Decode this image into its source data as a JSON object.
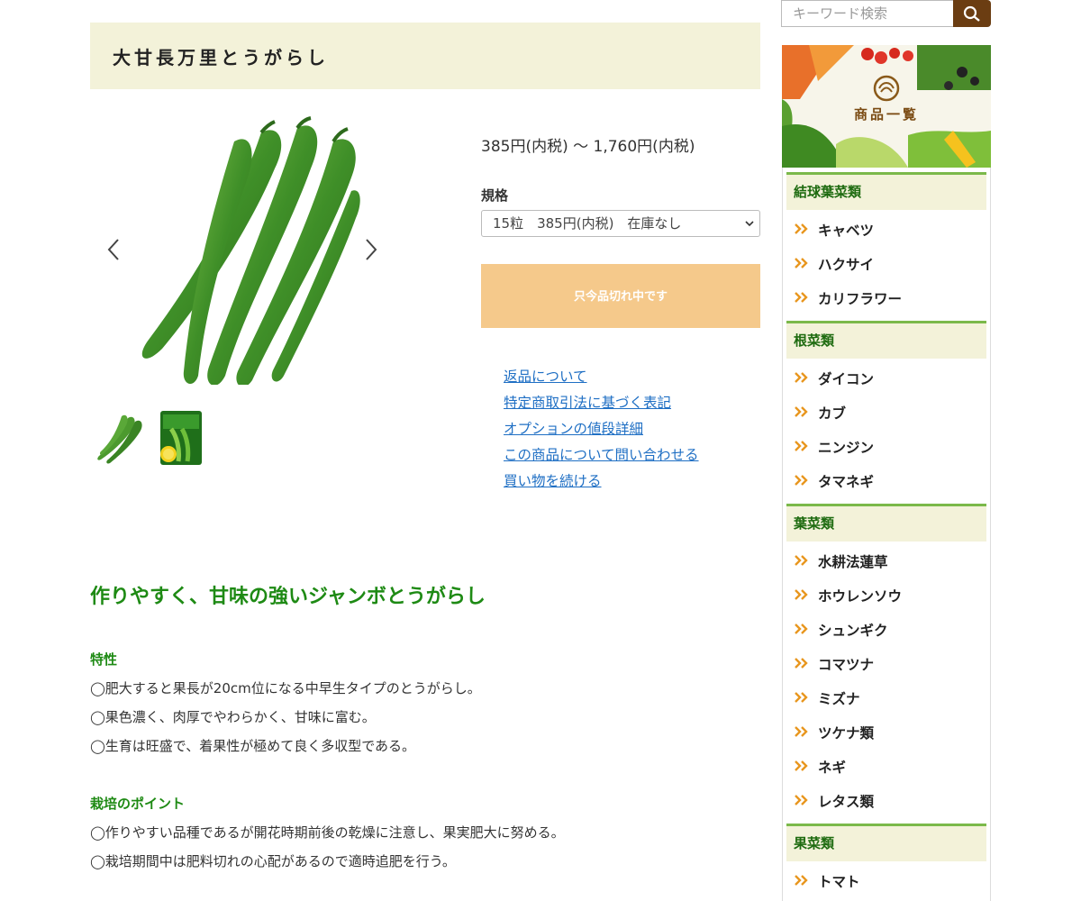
{
  "product": {
    "title": "大甘長万里とうがらし",
    "price": "385円(内税) 〜 1,760円(内税)",
    "spec_label": "規格",
    "spec_selected": "15粒　385円(内税)　在庫なし",
    "soldout_label": "只今品切れ中です",
    "links": [
      "返品について",
      "特定商取引法に基づく表記",
      "オプションの値段詳細",
      "この商品について問い合わせる",
      "買い物を続ける"
    ]
  },
  "description": {
    "catch": "作りやすく、甘味の強いジャンボとうがらし",
    "section1_title": "特性",
    "section1_lines": [
      "◯肥大すると果長が20cm位になる中早生タイプのとうがらし。",
      "◯果色濃く、肉厚でやわらかく、甘味に富む。",
      "◯生育は旺盛で、着果性が極めて良く多収型である。"
    ],
    "section2_title": "栽培のポイント",
    "section2_lines": [
      "◯作りやすい品種であるが開花時期前後の乾燥に注意し、果実肥大に努める。",
      "◯栽培期間中は肥料切れの心配があるので適時追肥を行う。"
    ]
  },
  "sidebar": {
    "search_placeholder": "キーワード検索",
    "banner_text": "商品一覧",
    "categories": [
      {
        "title": "結球葉菜類",
        "items": [
          "キャベツ",
          "ハクサイ",
          "カリフラワー"
        ]
      },
      {
        "title": "根菜類",
        "items": [
          "ダイコン",
          "カブ",
          "ニンジン",
          "タマネギ"
        ]
      },
      {
        "title": "葉菜類",
        "items": [
          "水耕法蓮草",
          "ホウレンソウ",
          "シュンギク",
          "コマツナ",
          "ミズナ",
          "ツケナ類",
          "ネギ",
          "レタス類"
        ]
      },
      {
        "title": "果菜類",
        "items": [
          "トマト"
        ]
      }
    ]
  },
  "colors": {
    "title_bg": "#f3f2d9",
    "accent_green": "#1e8a14",
    "soldout_bg": "#f5c98b",
    "link_blue": "#1f6fc4",
    "search_btn": "#6b3d12",
    "chevron_orange": "#e8961e"
  },
  "icons": {
    "search": "search-icon",
    "gallery_prev": "chevron-left-icon",
    "gallery_next": "chevron-right-icon",
    "category_bullet": "double-chevron-right-icon"
  }
}
